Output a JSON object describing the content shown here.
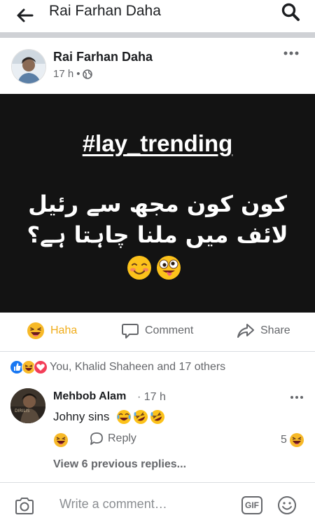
{
  "topbar": {
    "title": "Rai Farhan Daha"
  },
  "post": {
    "author": "Rai Farhan Daha",
    "time": "17 h",
    "separator": "•",
    "image": {
      "hashtag": "#lay_trending",
      "urdu_line1": "کون کون مجھ سے رئیل",
      "urdu_line2": "لائف میں ملنا چاہتا ہے؟"
    }
  },
  "actions": {
    "haha": "Haha",
    "comment": "Comment",
    "share": "Share"
  },
  "reactions": {
    "text": "You, Khalid Shaheen and 17 others"
  },
  "comment": {
    "author": "Mehbob Alam",
    "time": "· 17 h",
    "text": "Johny sins",
    "reply": "Reply",
    "reaction_count": "5"
  },
  "view_replies": "View 6 previous replies...",
  "composer": {
    "placeholder": "Write a comment…",
    "gif_label": "GIF"
  },
  "colors": {
    "haha_yellow": "#f7b928",
    "like_blue": "#1877f2",
    "love_red": "#f33e58",
    "text_gray": "#65676b"
  }
}
